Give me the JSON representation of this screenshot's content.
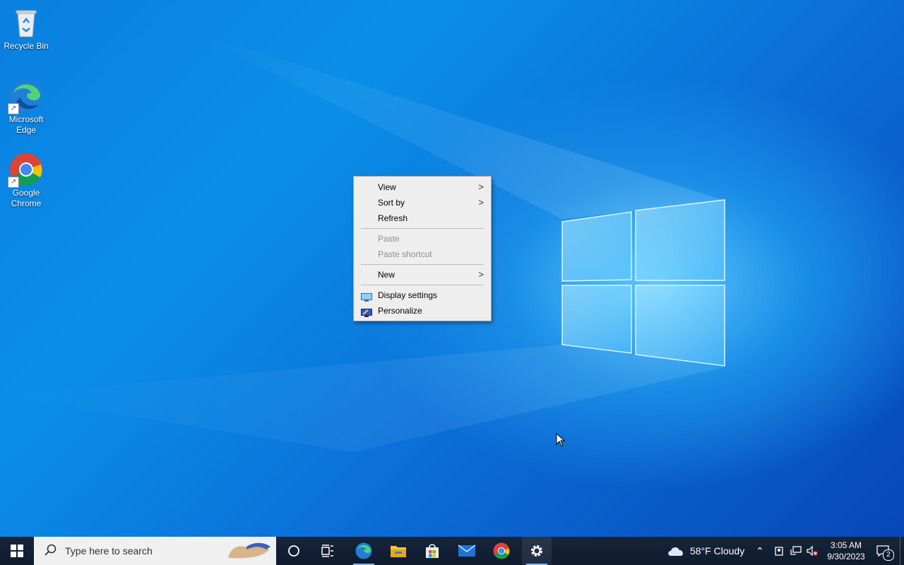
{
  "desktop": {
    "icons": [
      {
        "label": "Recycle Bin",
        "icon": "recycle-bin-icon"
      },
      {
        "label": "Microsoft Edge",
        "icon": "edge-icon"
      },
      {
        "label": "Google Chrome",
        "icon": "chrome-icon"
      }
    ]
  },
  "context_menu": {
    "view": "View",
    "sort_by": "Sort by",
    "refresh": "Refresh",
    "paste": "Paste",
    "paste_shortcut": "Paste shortcut",
    "new": "New",
    "display_settings": "Display settings",
    "personalize": "Personalize",
    "submenu_arrow": ">"
  },
  "taskbar": {
    "search_placeholder": "Type here to search",
    "apps": [
      "start-icon",
      "cortana-icon",
      "task-view-icon",
      "edge-icon",
      "file-explorer-icon",
      "store-icon",
      "mail-icon",
      "chrome-icon",
      "settings-icon"
    ],
    "weather": "58°F  Cloudy",
    "time": "3:05 AM",
    "date": "9/30/2023",
    "notification_count": "2"
  },
  "colors": {
    "taskbar": "#0f1b2e",
    "menu_bg": "#eeeeee",
    "accent": "#0a7fe0"
  }
}
